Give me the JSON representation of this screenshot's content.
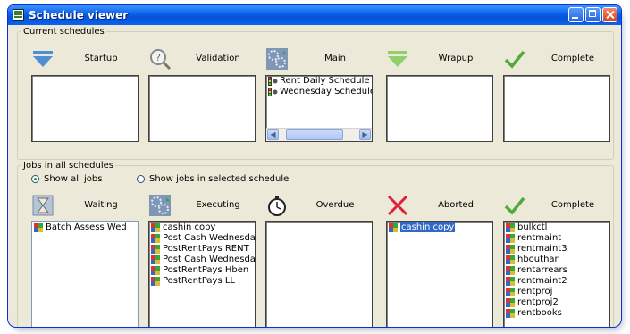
{
  "window": {
    "title": "Schedule viewer"
  },
  "current": {
    "legend": "Current schedules",
    "columns": [
      {
        "label": "Startup",
        "icon": "blue-arrow-down-icon",
        "items": []
      },
      {
        "label": "Validation",
        "icon": "magnifier-question-icon",
        "items": []
      },
      {
        "label": "Main",
        "icon": "gears-icon",
        "items": [
          "Rent Daily Schedule",
          "Wednesday Schedule I"
        ]
      },
      {
        "label": "Wrapup",
        "icon": "green-arrow-down-icon",
        "items": []
      },
      {
        "label": "Complete",
        "icon": "checkmark-icon",
        "items": []
      }
    ]
  },
  "jobs": {
    "legend": "Jobs in all schedules",
    "radio_all": "Show all jobs",
    "radio_selected": "Show jobs in selected schedule",
    "columns": [
      {
        "label": "Waiting",
        "icon": "hourglass-icon",
        "items": [
          "Batch Assess Wed"
        ]
      },
      {
        "label": "Executing",
        "icon": "gears-icon",
        "items": [
          "cashin copy",
          "Post Cash Wednesday",
          "PostRentPays RENT",
          "Post Cash Wednesday",
          "PostRentPays Hben",
          "PostRentPays LL"
        ]
      },
      {
        "label": "Overdue",
        "icon": "stopwatch-icon",
        "items": []
      },
      {
        "label": "Aborted",
        "icon": "red-x-icon",
        "items": [
          "cashin copy"
        ]
      },
      {
        "label": "Complete",
        "icon": "checkmark-icon",
        "items": [
          "bulkctl",
          "rentmaint",
          "rentmaint3",
          "hbouthar",
          "rentarrears",
          "rentmaint2",
          "rentproj",
          "rentproj2",
          "rentbooks"
        ]
      }
    ]
  },
  "colors": {
    "titlebar": "#0a5fe8",
    "selection": "#316ac5",
    "window_bg": "#ece9d8"
  }
}
